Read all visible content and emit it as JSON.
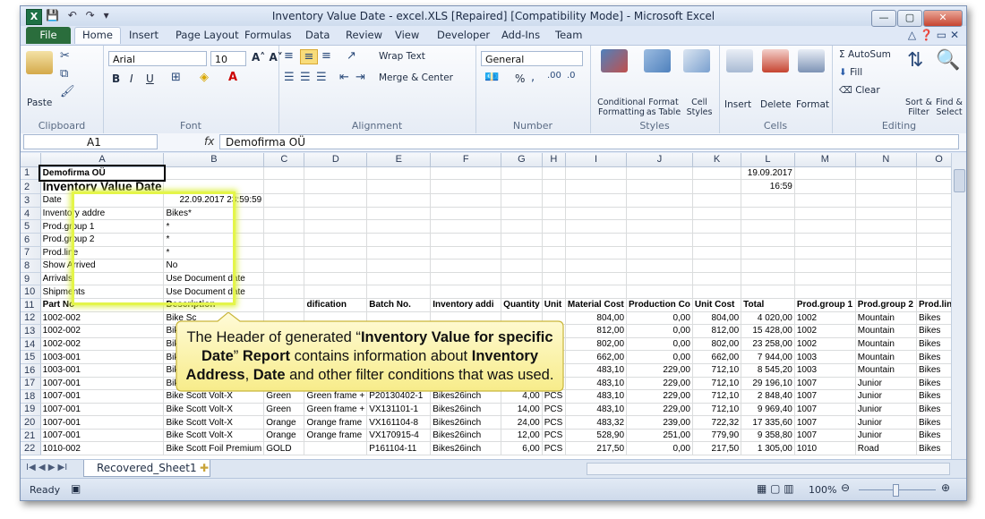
{
  "window": {
    "title": "Inventory Value Date - excel.XLS [Repaired]  [Compatibility Mode]  -  Microsoft Excel",
    "minimize": "—",
    "maximize": "▢",
    "close": "✕"
  },
  "tabs": [
    "File",
    "Home",
    "Insert",
    "Page Layout",
    "Formulas",
    "Data",
    "Review",
    "View",
    "Developer",
    "Add-Ins",
    "Team"
  ],
  "ribbon": {
    "clipboard": {
      "label": "Clipboard",
      "paste": "Paste"
    },
    "font": {
      "label": "Font",
      "name": "Arial",
      "size": "10",
      "bold": "B",
      "italic": "I",
      "underline": "U"
    },
    "alignment": {
      "label": "Alignment",
      "wrap": "Wrap Text",
      "merge": "Merge & Center"
    },
    "number": {
      "label": "Number",
      "format": "General",
      "percent": "%"
    },
    "styles": {
      "label": "Styles",
      "conditional": "Conditional Formatting",
      "format_table": "Format as Table",
      "cell_styles": "Cell Styles"
    },
    "cells": {
      "label": "Cells",
      "insert": "Insert",
      "delete": "Delete",
      "format": "Format"
    },
    "editing": {
      "label": "Editing",
      "autosum": "AutoSum",
      "fill": "Fill",
      "clear": "Clear",
      "sort": "Sort & Filter",
      "find": "Find & Select"
    }
  },
  "formula_bar": {
    "cell": "A1",
    "fx": "fx",
    "value": "Demofirma OÜ"
  },
  "columns": [
    "A",
    "B",
    "C",
    "D",
    "E",
    "F",
    "G",
    "H",
    "I",
    "J",
    "K",
    "L",
    "M",
    "N",
    "O"
  ],
  "rows": [
    {
      "n": "1",
      "cells": [
        "Demofirma OÜ",
        "",
        "",
        "",
        "",
        "",
        "",
        "",
        "",
        "",
        "",
        "19.09.2017",
        "",
        "",
        ""
      ]
    },
    {
      "n": "2",
      "cells": [
        "Inventory Value Date",
        "",
        "",
        "",
        "",
        "",
        "",
        "",
        "",
        "",
        "",
        "16:59",
        "",
        "",
        ""
      ]
    },
    {
      "n": "3",
      "cells": [
        "Date",
        "22.09.2017  23:59:59",
        "",
        "",
        "",
        "",
        "",
        "",
        "",
        "",
        "",
        "",
        "",
        "",
        ""
      ]
    },
    {
      "n": "4",
      "cells": [
        "Inventory addre",
        "Bikes*",
        "",
        "",
        "",
        "",
        "",
        "",
        "",
        "",
        "",
        "",
        "",
        "",
        ""
      ]
    },
    {
      "n": "5",
      "cells": [
        "Prod.group 1",
        "*",
        "",
        "",
        "",
        "",
        "",
        "",
        "",
        "",
        "",
        "",
        "",
        "",
        ""
      ]
    },
    {
      "n": "6",
      "cells": [
        "Prod.group 2",
        "*",
        "",
        "",
        "",
        "",
        "",
        "",
        "",
        "",
        "",
        "",
        "",
        "",
        ""
      ]
    },
    {
      "n": "7",
      "cells": [
        "Prod.line",
        "*",
        "",
        "",
        "",
        "",
        "",
        "",
        "",
        "",
        "",
        "",
        "",
        "",
        ""
      ]
    },
    {
      "n": "8",
      "cells": [
        "Show Arrived",
        "No",
        "",
        "",
        "",
        "",
        "",
        "",
        "",
        "",
        "",
        "",
        "",
        "",
        ""
      ]
    },
    {
      "n": "9",
      "cells": [
        "Arrivals",
        "Use Document date",
        "",
        "",
        "",
        "",
        "",
        "",
        "",
        "",
        "",
        "",
        "",
        "",
        ""
      ]
    },
    {
      "n": "10",
      "cells": [
        "Shipments",
        "Use Document date",
        "",
        "",
        "",
        "",
        "",
        "",
        "",
        "",
        "",
        "",
        "",
        "",
        ""
      ]
    },
    {
      "n": "11",
      "cells": [
        "Part No",
        "Description",
        "",
        "dification",
        "Batch No.",
        "Inventory addi",
        "Quantity",
        "Unit",
        "Material Cost",
        "Production Co",
        "Unit Cost",
        "Total",
        "Prod.group 1",
        "Prod.group 2",
        "Prod.line"
      ]
    },
    {
      "n": "12",
      "cells": [
        "1002-002",
        "Bike Sc",
        "",
        "",
        "",
        "",
        "",
        "",
        "804,00",
        "0,00",
        "804,00",
        "4 020,00",
        "1002",
        "Mountain",
        "Bikes"
      ]
    },
    {
      "n": "13",
      "cells": [
        "1002-002",
        "Bike Sc",
        "",
        "",
        "",
        "",
        "",
        "",
        "812,00",
        "0,00",
        "812,00",
        "15 428,00",
        "1002",
        "Mountain",
        "Bikes"
      ]
    },
    {
      "n": "14",
      "cells": [
        "1002-002",
        "Bike Sc",
        "",
        "",
        "",
        "",
        "",
        "",
        "802,00",
        "0,00",
        "802,00",
        "23 258,00",
        "1002",
        "Mountain",
        "Bikes"
      ]
    },
    {
      "n": "15",
      "cells": [
        "1003-001",
        "Bike Sc",
        "",
        "",
        "",
        "",
        "",
        "",
        "662,00",
        "0,00",
        "662,00",
        "7 944,00",
        "1003",
        "Mountain",
        "Bikes"
      ]
    },
    {
      "n": "16",
      "cells": [
        "1003-001",
        "Bike Sc",
        "",
        "",
        "",
        "",
        "",
        "",
        "483,10",
        "229,00",
        "712,10",
        "8 545,20",
        "1003",
        "Mountain",
        "Bikes"
      ]
    },
    {
      "n": "17",
      "cells": [
        "1007-001",
        "Bike Scott Volt-X",
        "Green",
        "Green frame +",
        "P20130108-19",
        "Bikes26inch",
        "41,00",
        "PCS",
        "483,10",
        "229,00",
        "712,10",
        "29 196,10",
        "1007",
        "Junior",
        "Bikes"
      ]
    },
    {
      "n": "18",
      "cells": [
        "1007-001",
        "Bike Scott Volt-X",
        "Green",
        "Green frame +",
        "P20130402-1",
        "Bikes26inch",
        "4,00",
        "PCS",
        "483,10",
        "229,00",
        "712,10",
        "2 848,40",
        "1007",
        "Junior",
        "Bikes"
      ]
    },
    {
      "n": "19",
      "cells": [
        "1007-001",
        "Bike Scott Volt-X",
        "Green",
        "Green frame +",
        "VX131101-1",
        "Bikes26inch",
        "14,00",
        "PCS",
        "483,10",
        "229,00",
        "712,10",
        "9 969,40",
        "1007",
        "Junior",
        "Bikes"
      ]
    },
    {
      "n": "20",
      "cells": [
        "1007-001",
        "Bike Scott Volt-X",
        "Orange",
        "Orange frame",
        "VX161104-8",
        "Bikes26inch",
        "24,00",
        "PCS",
        "483,32",
        "239,00",
        "722,32",
        "17 335,60",
        "1007",
        "Junior",
        "Bikes"
      ]
    },
    {
      "n": "21",
      "cells": [
        "1007-001",
        "Bike Scott Volt-X",
        "Orange",
        "Orange frame",
        "VX170915-4",
        "Bikes26inch",
        "12,00",
        "PCS",
        "528,90",
        "251,00",
        "779,90",
        "9 358,80",
        "1007",
        "Junior",
        "Bikes"
      ]
    },
    {
      "n": "22",
      "cells": [
        "1010-002",
        "Bike Scott Foil Premium",
        "GOLD",
        "",
        "P161104-11",
        "Bikes26inch",
        "6,00",
        "PCS",
        "217,50",
        "0,00",
        "217,50",
        "1 305,00",
        "1010",
        "Road",
        "Bikes"
      ]
    }
  ],
  "callout": {
    "t1": "The Header of generated “",
    "b1": "Inventory Value for specific Date",
    "t2": "” ",
    "b2": "Report",
    "t3": " contains information about ",
    "b3": "Inventory Address",
    "t4": ", ",
    "b4": "Date",
    "t5": " and other filter conditions that was used."
  },
  "sheet_tab": "Recovered_Sheet1",
  "status": {
    "ready": "Ready",
    "zoom": "100%"
  },
  "colors": {
    "accent": "#1e7145",
    "highlight": "#e4f54a",
    "callout_fill": "#fdf6b2"
  }
}
